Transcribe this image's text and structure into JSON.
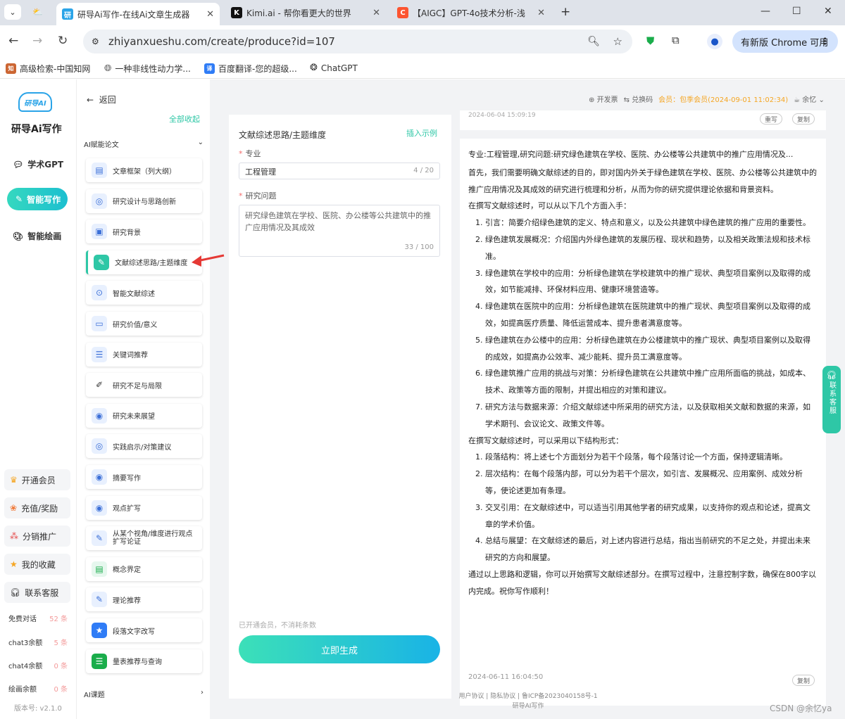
{
  "browser": {
    "tabs": [
      {
        "title": "研导Ai写作-在线Ai文章生成器"
      },
      {
        "title": "Kimi.ai - 帮你看更大的世界"
      },
      {
        "title": "【AIGC】GPT-4o技术分析-浅"
      }
    ],
    "url": "zhiyanxueshu.com/create/produce?id=107",
    "update_label": "有新版 Chrome 可用",
    "bookmarks": [
      "高级检索-中国知网",
      "一种非线性动力学...",
      "百度翻译-您的超级...",
      "ChatGPT"
    ]
  },
  "sidebar": {
    "logo_mark": "研导AI",
    "brand": "研导Ai写作",
    "items": [
      {
        "label": "学术GPT"
      },
      {
        "label": "智能写作"
      },
      {
        "label": "智能绘画"
      }
    ],
    "member_items": [
      "开通会员",
      "充值/奖励",
      "分销推广",
      "我的收藏",
      "联系客服"
    ],
    "quotas": [
      {
        "label": "免费对话",
        "value": "52 条"
      },
      {
        "label": "chat3余额",
        "value": "5 条"
      },
      {
        "label": "chat4余额",
        "value": "0 条"
      },
      {
        "label": "绘画余额",
        "value": "0 条"
      }
    ],
    "version": "版本号: v2.1.0"
  },
  "functions": {
    "back": "返回",
    "collapse_all": "全部收起",
    "group_title": "AI赋能论文",
    "group2_title": "AI课题",
    "items": [
      "文章框架（列大纲）",
      "研究设计与思路创新",
      "研究背景",
      "文献综述思路/主题维度",
      "智能文献综述",
      "研究价值/意义",
      "关键词推荐",
      "研究不足与局限",
      "研究未来展望",
      "实践启示/对策建议",
      "摘要写作",
      "观点扩写",
      "从某个视角/维度进行观点扩写论证",
      "概念界定",
      "理论推荐",
      "段落文字改写",
      "量表推荐与查询"
    ]
  },
  "form": {
    "title": "文献综述思路/主题维度",
    "insert_example": "插入示例",
    "major_label": "专业",
    "major_value": "工程管理",
    "major_count": "4 / 20",
    "question_label": "研究问题",
    "question_value": "研究绿色建筑在学校、医院、办公楼等公共建筑中的推广应用情况及其成效",
    "question_count": "33 / 100",
    "tip": "已开通会员，不消耗条数",
    "generate": "立即生成"
  },
  "topbar": {
    "invoice": "开发票",
    "redeem": "兑换码",
    "vip": "会员：包季会员(2024-09-01 11:02:34)",
    "user": "余忆"
  },
  "result": {
    "prev_time": "2024-06-04 15:09:19",
    "rewrite": "重写",
    "copy": "复制",
    "paragraphs": [
      "专业:工程管理,研究问题:研究绿色建筑在学校、医院、办公楼等公共建筑中的推广应用情况及...",
      "首先，我们需要明确文献综述的目的，即对国内外关于绿色建筑在学校、医院、办公楼等公共建筑中的推广应用情况及其成效的研究进行梳理和分析，从而为你的研究提供理论依据和背景资料。",
      "在撰写文献综述时，可以从以下几个方面入手："
    ],
    "list1": [
      "1. 引言：简要介绍绿色建筑的定义、特点和意义，以及公共建筑中绿色建筑的推广应用的重要性。",
      "2. 绿色建筑发展概况：介绍国内外绿色建筑的发展历程、现状和趋势，以及相关政策法规和技术标准。",
      "3. 绿色建筑在学校中的应用：分析绿色建筑在学校建筑中的推广现状、典型项目案例以及取得的成效，如节能减排、环保材料应用、健康环境营造等。",
      "4. 绿色建筑在医院中的应用：分析绿色建筑在医院建筑中的推广现状、典型项目案例以及取得的成效，如提高医疗质量、降低运营成本、提升患者满意度等。",
      "5. 绿色建筑在办公楼中的应用：分析绿色建筑在办公楼建筑中的推广现状、典型项目案例以及取得的成效，如提高办公效率、减少能耗、提升员工满意度等。",
      "6. 绿色建筑推广应用的挑战与对策：分析绿色建筑在公共建筑中推广应用所面临的挑战，如成本、技术、政策等方面的限制，并提出相应的对策和建议。",
      "7. 研究方法与数据来源：介绍文献综述中所采用的研究方法，以及获取相关文献和数据的来源，如学术期刊、会议论文、政策文件等。"
    ],
    "mid": "在撰写文献综述时，可以采用以下结构形式：",
    "list2": [
      "1. 段落结构：将上述七个方面划分为若干个段落，每个段落讨论一个方面，保持逻辑清晰。",
      "2. 层次结构：在每个段落内部，可以分为若干个层次，如引言、发展概况、应用案例、成效分析等，使论述更加有条理。",
      "3. 交叉引用：在文献综述中，可以适当引用其他学者的研究成果，以支持你的观点和论述，提高文章的学术价值。",
      "4. 总结与展望：在文献综述的最后，对上述内容进行总结，指出当前研究的不足之处，并提出未来研究的方向和展望。"
    ],
    "end": "通过以上思路和逻辑，你可以开始撰写文献综述部分。在撰写过程中，注意控制字数，确保在800字以内完成。祝你写作顺利！",
    "time": "2024-06-11 16:04:50"
  },
  "footer": {
    "line1": "用户协议 | 隐私协议 | 鲁ICP备2023040158号-1",
    "line2": "研导AI写作"
  },
  "service_label": "联系客服",
  "watermark": "CSDN @余忆ya",
  "colors": {
    "accent": "#2ec7a6",
    "gradient_start": "#3ce0b8",
    "gradient_end": "#19b3e6",
    "vip": "#f5a623"
  }
}
